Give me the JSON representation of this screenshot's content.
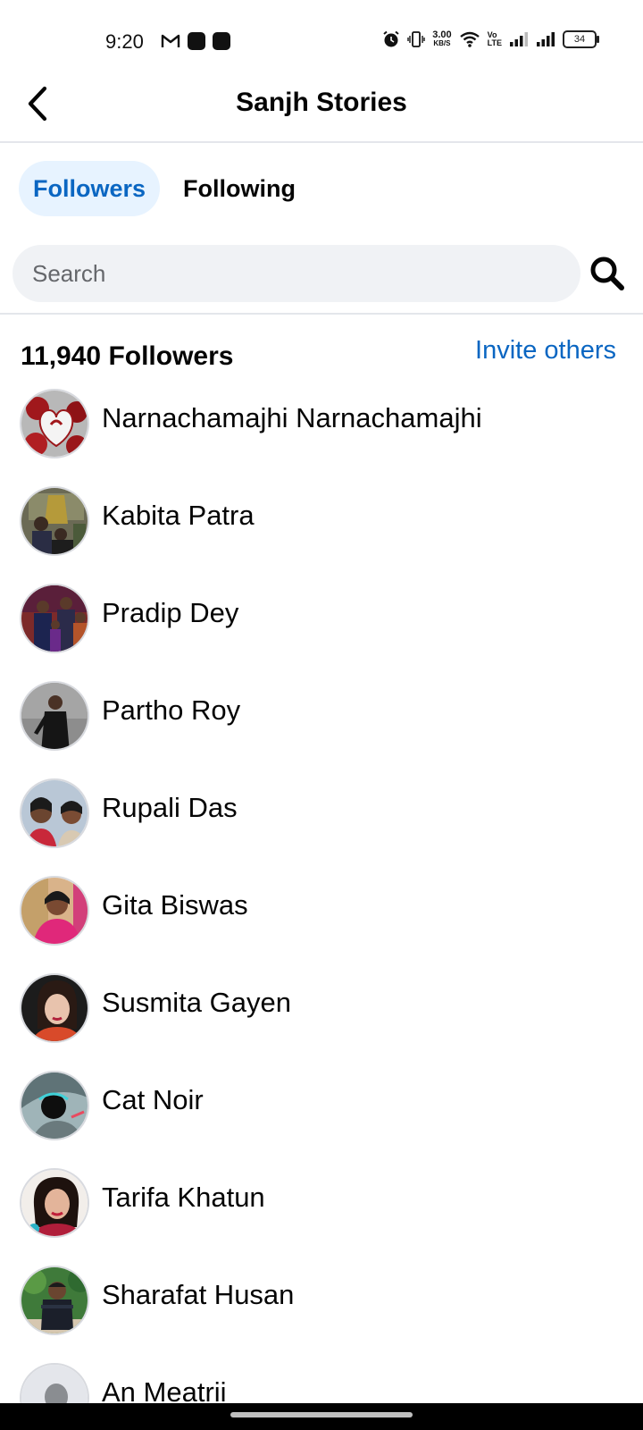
{
  "status_bar": {
    "time": "9:20",
    "net_speed_value": "3.00",
    "net_speed_unit": "KB/S",
    "lte_top": "Vo",
    "lte_bottom": "LTE",
    "battery": "34"
  },
  "header": {
    "title": "Sanjh Stories"
  },
  "tabs": [
    {
      "label": "Followers",
      "active": true
    },
    {
      "label": "Following",
      "active": false
    }
  ],
  "search": {
    "placeholder": "Search"
  },
  "followers": {
    "count_label": "11,940 Followers",
    "invite_label": "Invite others",
    "items": [
      {
        "name": "Narnachamajhi Narnachamajhi"
      },
      {
        "name": "Kabita Patra"
      },
      {
        "name": "Pradip Dey"
      },
      {
        "name": "Partho Roy"
      },
      {
        "name": "Rupali Das"
      },
      {
        "name": "Gita Biswas"
      },
      {
        "name": "Susmita Gayen"
      },
      {
        "name": "Cat Noir"
      },
      {
        "name": "Tarifa Khatun"
      },
      {
        "name": "Sharafat Husan"
      },
      {
        "name": "An Meatrii"
      }
    ]
  },
  "colors": {
    "accent": "#0a66c2",
    "tab_active_bg": "#e7f3ff",
    "search_bg": "#f0f2f5",
    "divider": "#e4e6eb"
  }
}
